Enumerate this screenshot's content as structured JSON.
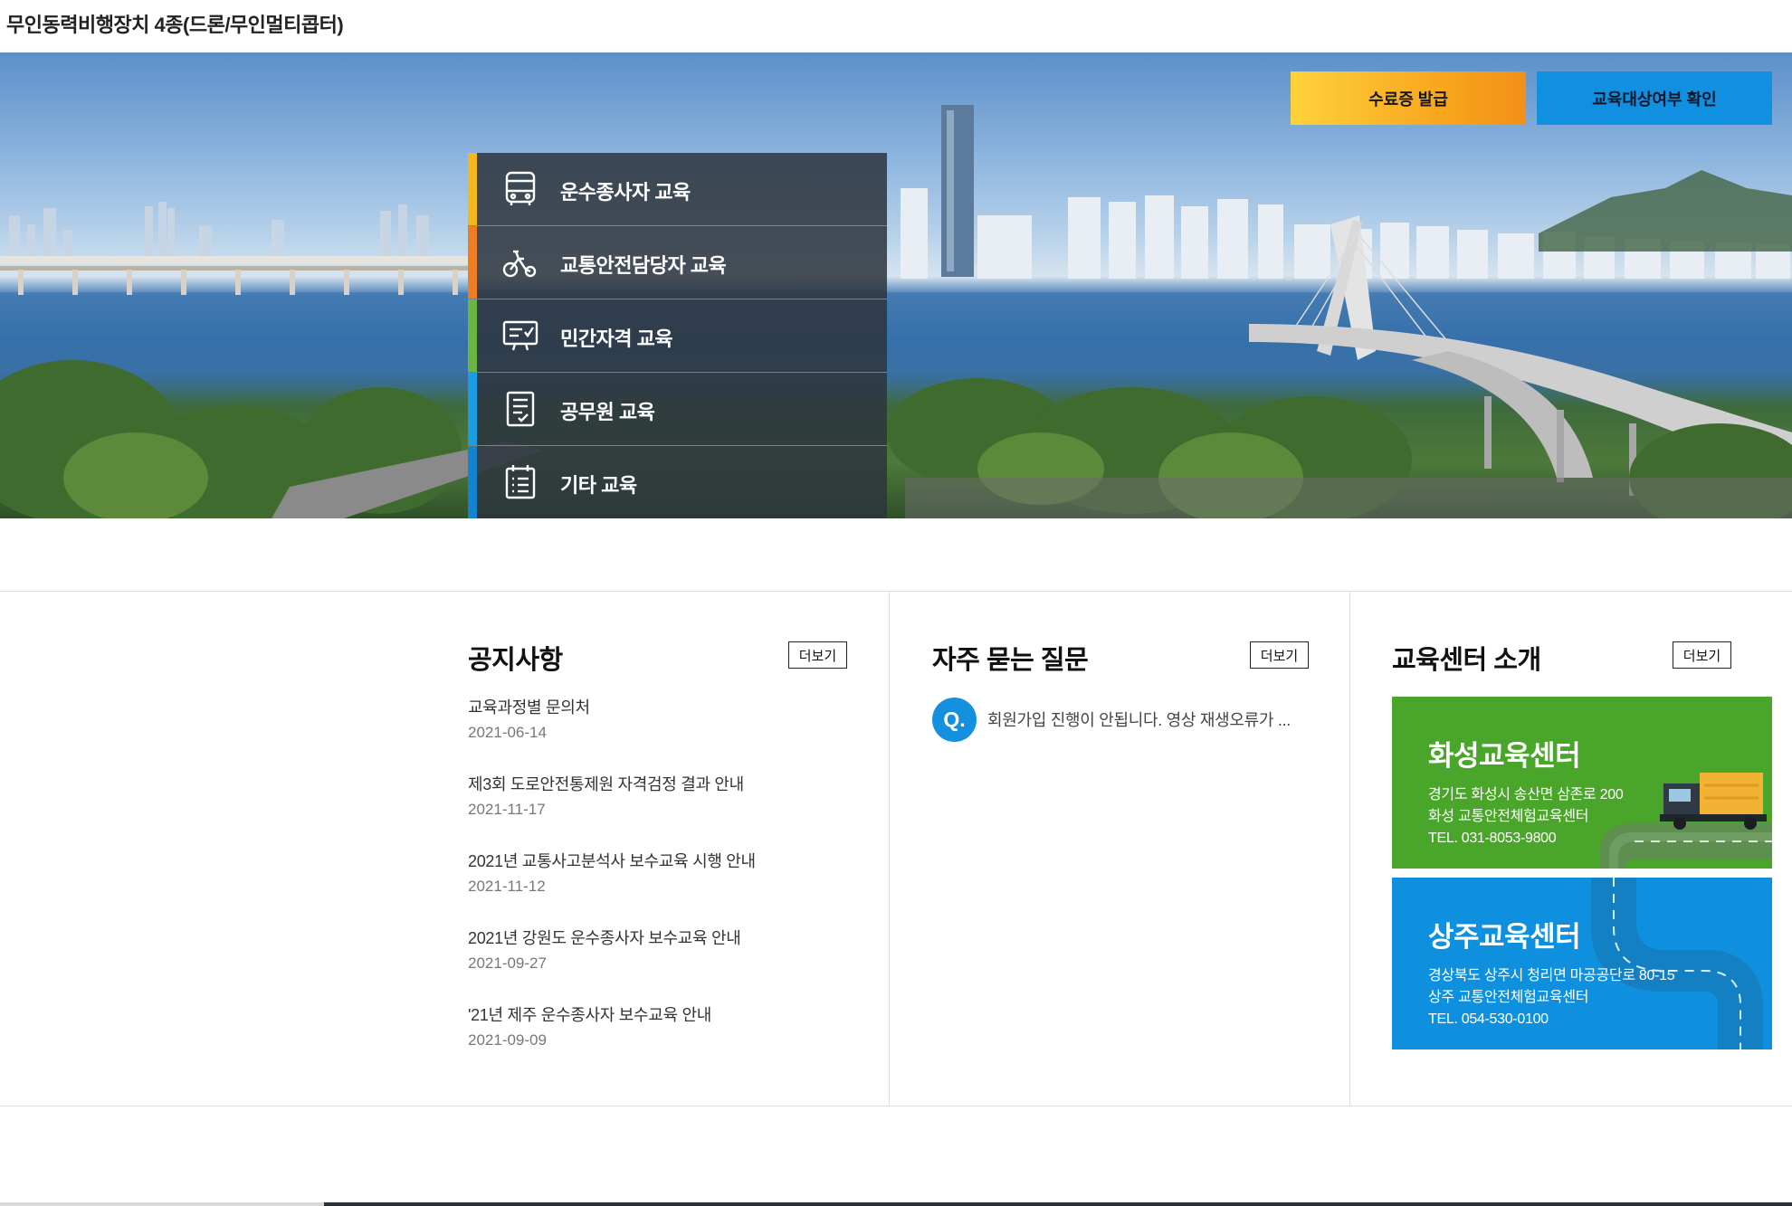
{
  "header": {
    "title": "무인동력비행장치 4종(드론/무인멀티콥터)"
  },
  "hero": {
    "cta_certificate": "수료증 발급",
    "cta_eligibility": "교육대상여부 확인",
    "menu": [
      {
        "label": "운수종사자 교육",
        "icon": "bus-icon",
        "color": "#f5b81c"
      },
      {
        "label": "교통안전담당자 교육",
        "icon": "bicycle-icon",
        "color": "#ef7d22"
      },
      {
        "label": "민간자격 교육",
        "icon": "monitor-check-icon",
        "color": "#6bb543"
      },
      {
        "label": "공무원 교육",
        "icon": "document-icon",
        "color": "#1a9de3"
      },
      {
        "label": "기타 교육",
        "icon": "calendar-list-icon",
        "color": "#1483cf"
      }
    ]
  },
  "notice": {
    "title": "공지사항",
    "more": "더보기",
    "items": [
      {
        "title": "교육과정별 문의처",
        "date": "2021-06-14"
      },
      {
        "title": "제3회 도로안전통제원 자격검정 결과 안내",
        "date": "2021-11-17"
      },
      {
        "title": "2021년 교통사고분석사 보수교육 시행 안내",
        "date": "2021-11-12"
      },
      {
        "title": "2021년 강원도 운수종사자 보수교육 안내",
        "date": "2021-09-27"
      },
      {
        "title": "'21년 제주 운수종사자 보수교육 안내",
        "date": "2021-09-09"
      }
    ]
  },
  "faq": {
    "title": "자주 묻는 질문",
    "more": "더보기",
    "badge": "Q.",
    "items": [
      {
        "question": "회원가입 진행이 안됩니다. 영상 재생오류가 ..."
      }
    ]
  },
  "centers": {
    "title": "교육센터 소개",
    "more": "더보기",
    "items": [
      {
        "name": "화성교육센터",
        "address": "경기도 화성시 송산면 삼존로 200",
        "facility": "화성 교통안전체험교육센터",
        "tel": "TEL. 031-8053-9800",
        "color": "#4aa62a"
      },
      {
        "name": "상주교육센터",
        "address": "경상북도 상주시 청리면 마공공단로 80-15",
        "facility": "상주 교통안전체험교육센터",
        "tel": "TEL. 054-530-0100",
        "color": "#0f90de"
      }
    ]
  }
}
